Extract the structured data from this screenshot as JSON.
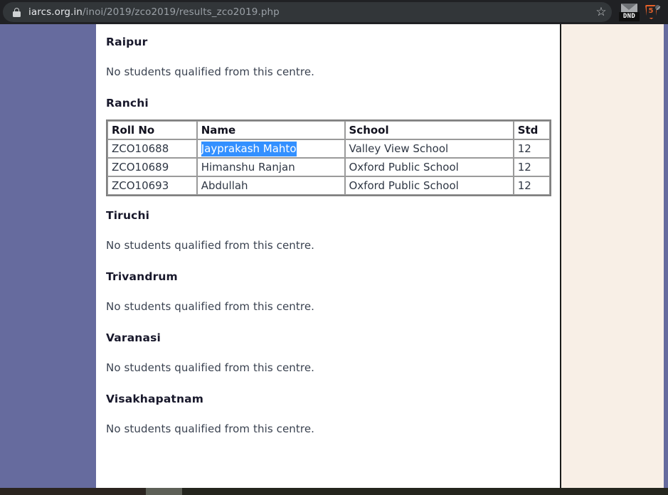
{
  "browser": {
    "url_host": "iarcs.org.in",
    "url_path": "/inoi/2019/zco2019/results_zco2019.php",
    "lock_icon": "lock-icon",
    "star_icon": "☆",
    "extensions": [
      {
        "name": "dnd-mail-extension",
        "badge": "DND"
      },
      {
        "name": "html5-extension",
        "label": "5"
      }
    ]
  },
  "page": {
    "empty_message": "No students qualified from this centre.",
    "sections": [
      {
        "heading": "Raipur",
        "has_table": false
      },
      {
        "heading": "Ranchi",
        "has_table": true
      },
      {
        "heading": "Tiruchi",
        "has_table": false
      },
      {
        "heading": "Trivandrum",
        "has_table": false
      },
      {
        "heading": "Varanasi",
        "has_table": false
      },
      {
        "heading": "Visakhapatnam",
        "has_table": false
      }
    ],
    "table": {
      "headers": [
        "Roll No",
        "Name",
        "School",
        "Std"
      ],
      "rows": [
        {
          "roll": "ZCO10688",
          "name": "Jayprakash Mahto",
          "school": "Valley View School",
          "std": "12",
          "selected": true
        },
        {
          "roll": "ZCO10689",
          "name": "Himanshu Ranjan",
          "school": "Oxford Public School",
          "std": "12",
          "selected": false
        },
        {
          "roll": "ZCO10693",
          "name": "Abdullah",
          "school": "Oxford Public School",
          "std": "12",
          "selected": false
        }
      ]
    }
  },
  "colors": {
    "selection_blue": "#3390ff",
    "page_backdrop": "#666b9e",
    "cream_panel": "#f8efe6",
    "chrome": "#202124"
  }
}
